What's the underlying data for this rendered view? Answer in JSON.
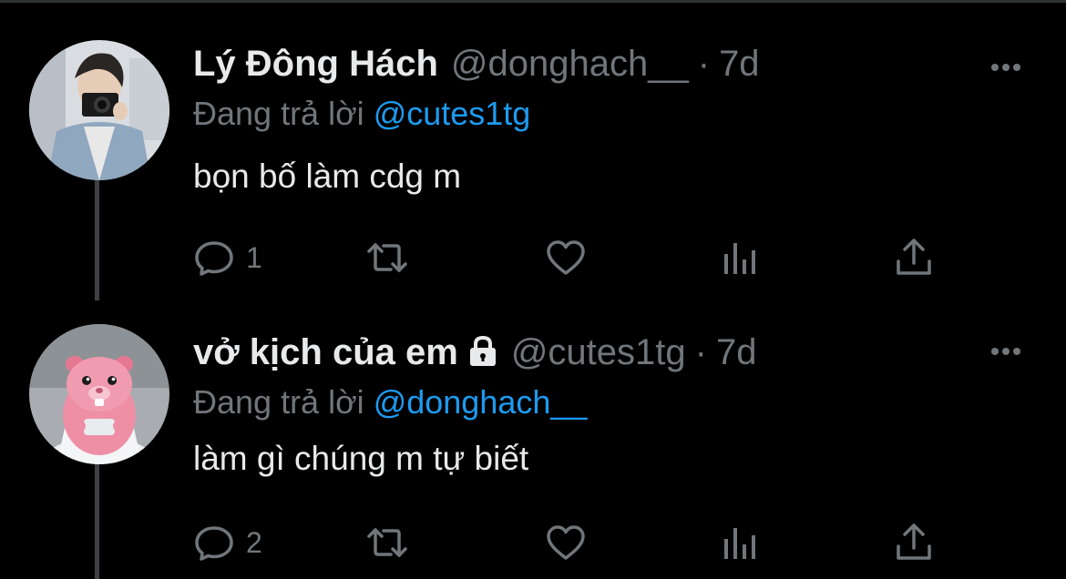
{
  "tweets": [
    {
      "author_name": "Lý Đông Hách",
      "handle": "@donghach__",
      "separator": "·",
      "time": "7d",
      "replying_prefix": "Đang trả lời",
      "replying_to": "@cutes1tg",
      "text": "bọn bố làm cdg m",
      "reply_count": "1",
      "locked": false
    },
    {
      "author_name": "vở kịch của em",
      "handle": "@cutes1tg",
      "separator": "·",
      "time": "7d",
      "replying_prefix": "Đang trả lời",
      "replying_to": "@donghach__",
      "text": "làm gì chúng m tự biết",
      "reply_count": "2",
      "locked": true
    }
  ],
  "colors": {
    "background": "#000000",
    "primary_text": "#e7e9ea",
    "secondary_text": "#71767b",
    "accent": "#1d9bf0",
    "thread_line": "#3e4144"
  },
  "icons": {
    "reply": "reply-icon",
    "retweet": "retweet-icon",
    "like": "heart-icon",
    "analytics": "analytics-icon",
    "share": "share-icon",
    "more": "more-icon",
    "lock": "lock-icon"
  }
}
